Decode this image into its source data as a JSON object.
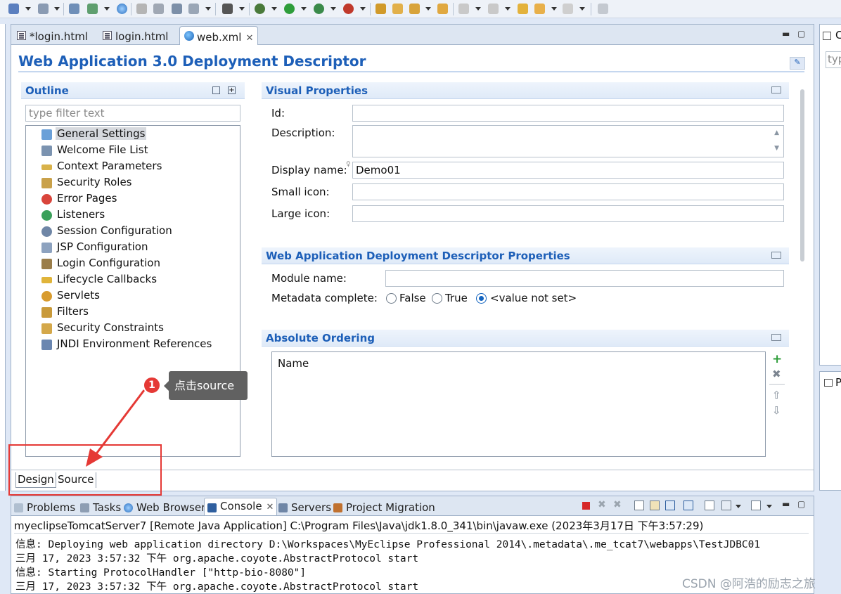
{
  "tabs": [
    {
      "label": "*login.html"
    },
    {
      "label": "login.html"
    },
    {
      "label": "web.xml"
    }
  ],
  "editor": {
    "title": "Web Application 3.0 Deployment Descriptor"
  },
  "outline": {
    "title": "Outline",
    "filter_placeholder": "type filter text",
    "items": [
      {
        "label": "General Settings",
        "icon": "settings-icon"
      },
      {
        "label": "Welcome File List",
        "icon": "welcome-file-icon"
      },
      {
        "label": "Context Parameters",
        "icon": "parameters-icon"
      },
      {
        "label": "Security Roles",
        "icon": "security-role-icon"
      },
      {
        "label": "Error Pages",
        "icon": "error-page-icon"
      },
      {
        "label": "Listeners",
        "icon": "listener-icon"
      },
      {
        "label": "Session Configuration",
        "icon": "session-icon"
      },
      {
        "label": "JSP Configuration",
        "icon": "jsp-icon"
      },
      {
        "label": "Login Configuration",
        "icon": "login-icon"
      },
      {
        "label": "Lifecycle Callbacks",
        "icon": "lifecycle-icon"
      },
      {
        "label": "Servlets",
        "icon": "servlet-icon"
      },
      {
        "label": "Filters",
        "icon": "filter-icon"
      },
      {
        "label": "Security Constraints",
        "icon": "security-constraint-icon"
      },
      {
        "label": "JNDI Environment References",
        "icon": "jndi-icon"
      }
    ]
  },
  "visual": {
    "title": "Visual Properties",
    "id_label": "Id:",
    "id_value": "",
    "description_label": "Description:",
    "display_name_label": "Display name:",
    "display_name_value": "Demo01",
    "small_icon_label": "Small icon:",
    "large_icon_label": "Large icon:"
  },
  "descriptor": {
    "title": "Web Application Deployment Descriptor Properties",
    "module_name_label": "Module name:",
    "metadata_label": "Metadata complete:",
    "options": [
      "False",
      "True",
      "<value not set>"
    ],
    "selected": "<value not set>"
  },
  "ordering": {
    "title": "Absolute Ordering",
    "column": "Name"
  },
  "annotation": {
    "number": "1",
    "tooltip": "点击source"
  },
  "bottom_tabs": {
    "design": "Design",
    "source": "Source"
  },
  "console_panel": {
    "tabs": [
      "Problems",
      "Tasks",
      "Web Browser",
      "Console",
      "Servers",
      "Project Migration"
    ],
    "header": "myeclipseTomcatServer7 [Remote Java Application] C:\\Program Files\\Java\\jdk1.8.0_341\\bin\\javaw.exe (2023年3月17日 下午3:57:29)",
    "lines": [
      "信息: Deploying web application directory D:\\Workspaces\\MyEclipse Professional 2014\\.metadata\\.me_tcat7\\webapps\\TestJDBC01",
      "三月 17, 2023 3:57:32 下午 org.apache.coyote.AbstractProtocol start",
      "信息: Starting ProtocolHandler [\"http-bio-8080\"]",
      "三月 17, 2023 3:57:32 下午 org.apache.coyote.AbstractProtocol start"
    ]
  },
  "right_panel": {
    "top_letter": "C",
    "input_text": "typ",
    "bottom_letter": "P"
  },
  "watermark": "CSDN @阿浩的励志之旅",
  "colors": {
    "accent": "#1d5fb8",
    "annotation_red": "#e53935",
    "highlight_box": "#e53935"
  }
}
